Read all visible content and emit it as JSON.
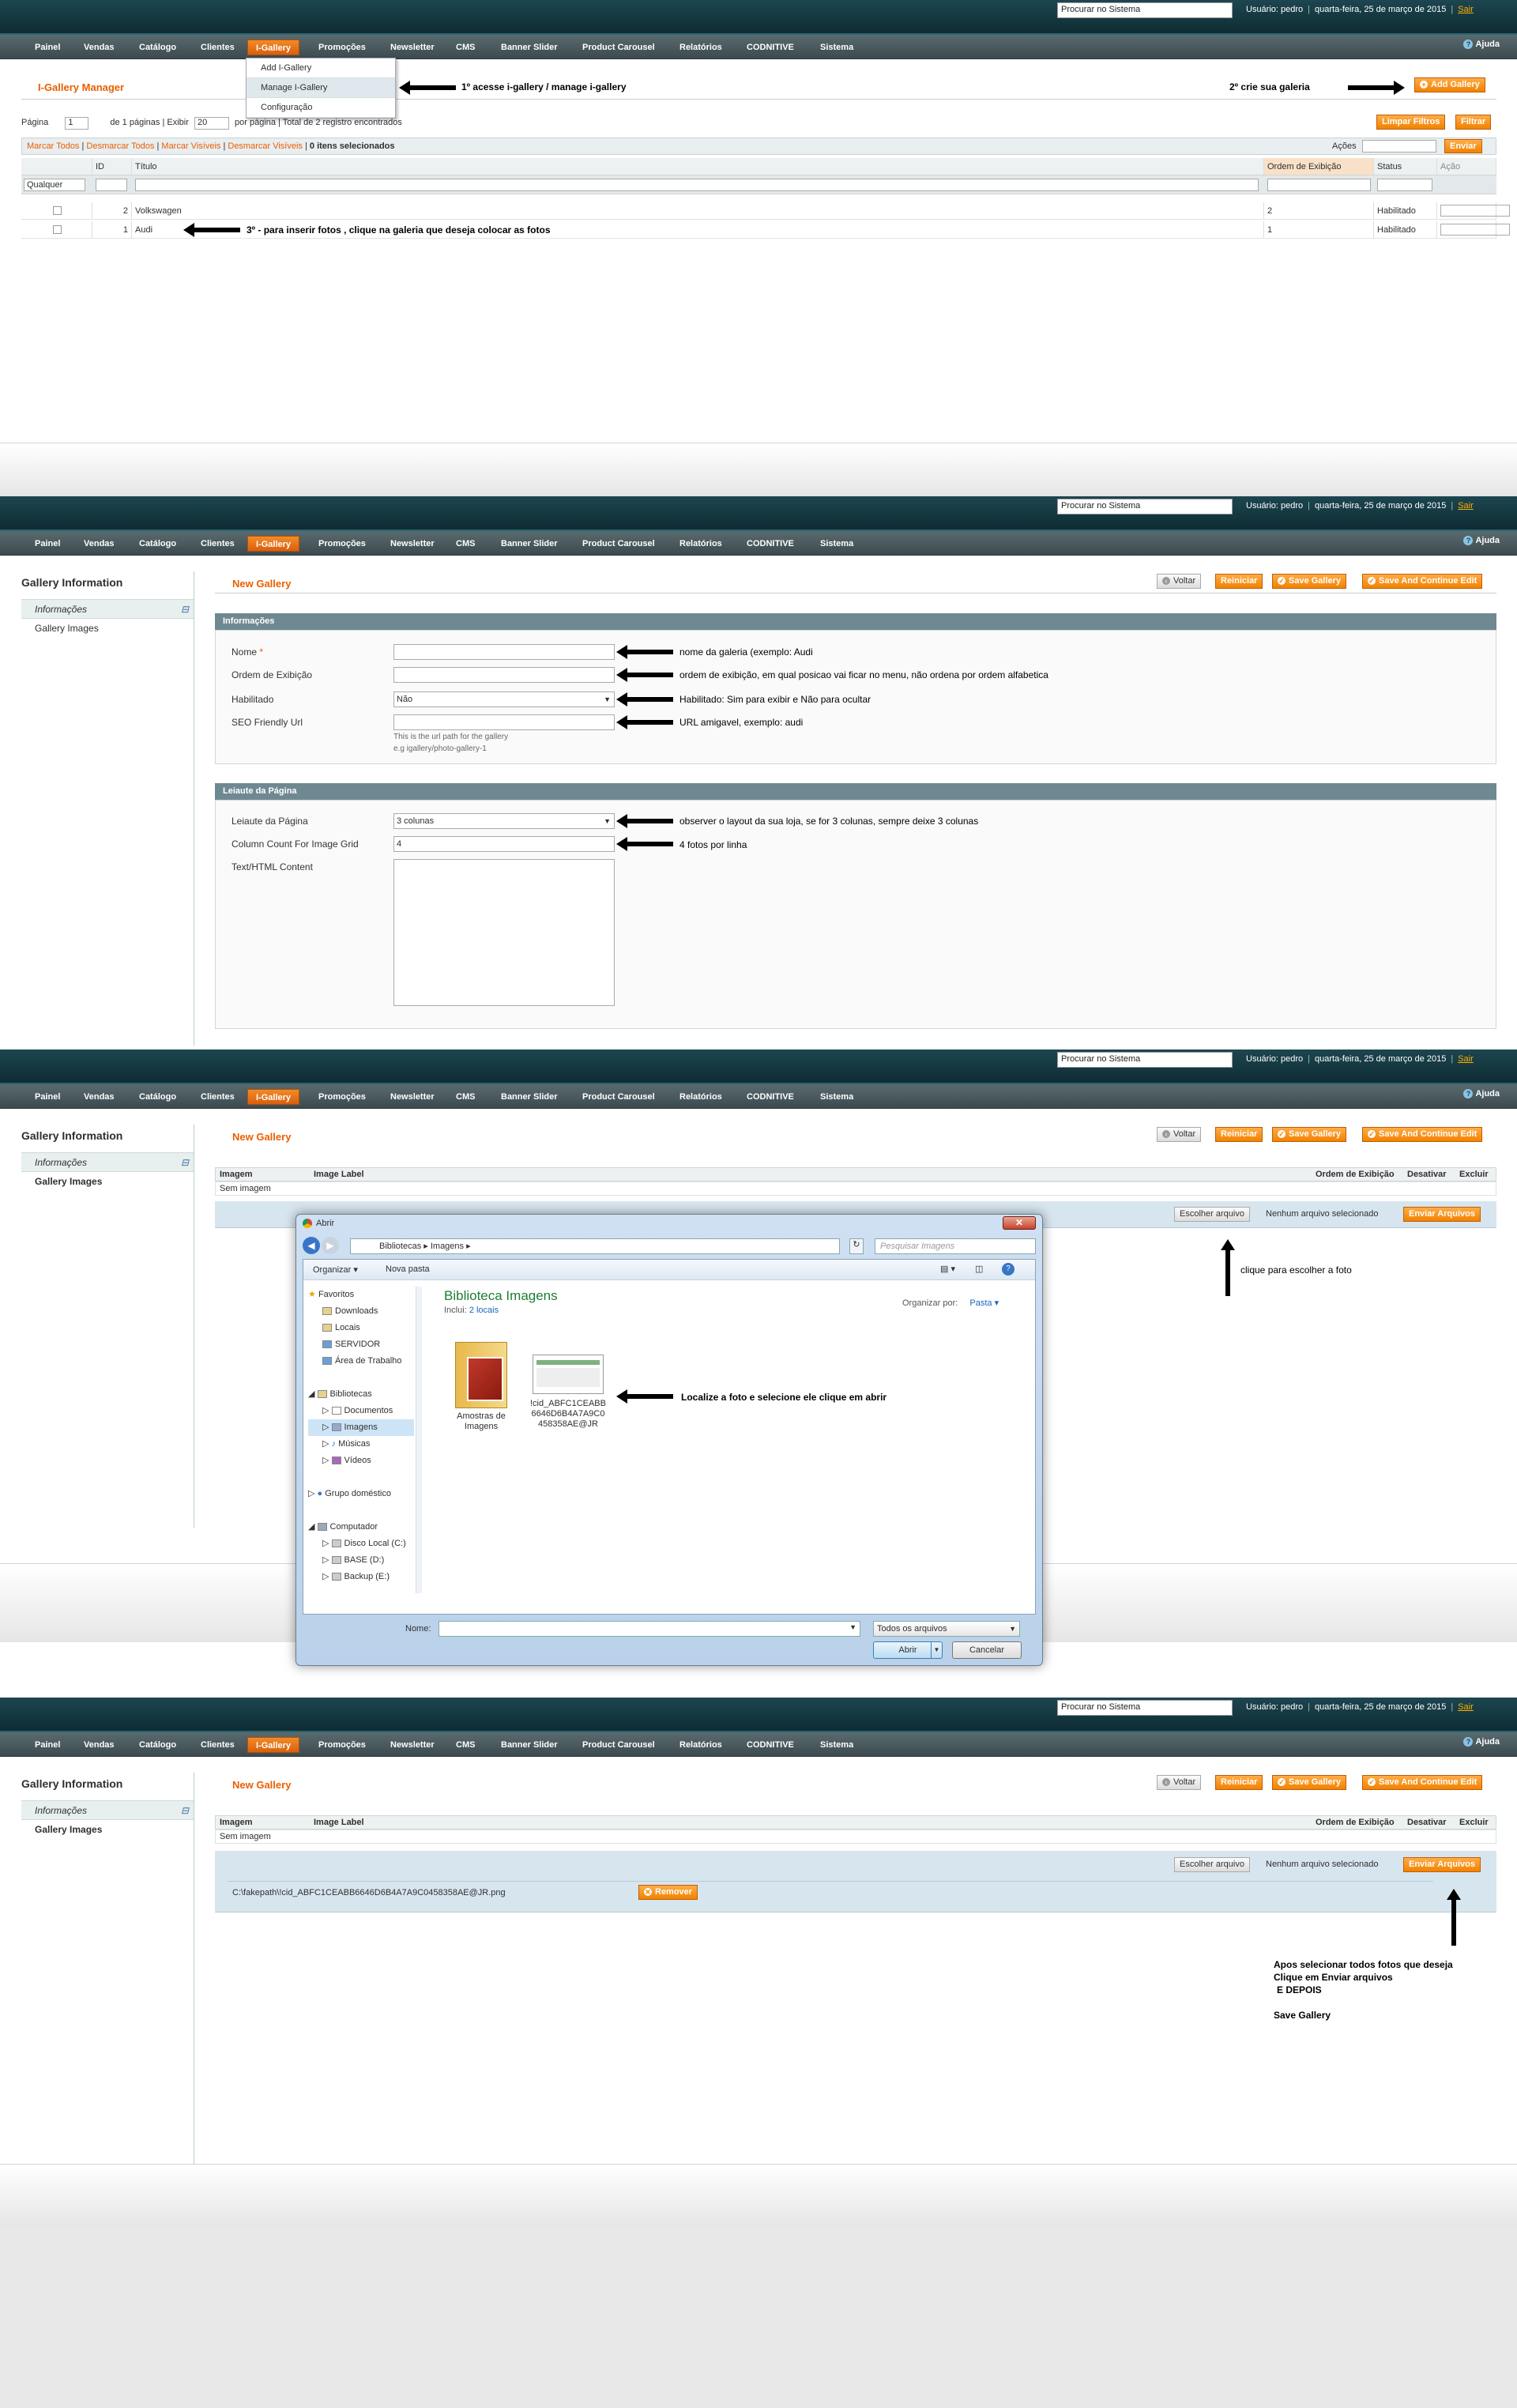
{
  "common": {
    "search_placeholder": "Procurar no Sistema",
    "user_text": "Usuário: pedro",
    "date_text": "quarta-feira, 25 de março de 2015",
    "logout": "Sair",
    "help": "Ajuda",
    "nav": [
      "Painel",
      "Vendas",
      "Catálogo",
      "Clientes",
      "I-Gallery",
      "Promoções",
      "Newsletter",
      "CMS",
      "Banner Slider",
      "Product Carousel",
      "Relatórios",
      "CODNITIVE",
      "Sistema"
    ],
    "buttons": {
      "back": "Voltar",
      "reset": "Reiniciar",
      "save": "Save Gallery",
      "save_continue": "Save And Continue Edit"
    },
    "sidebar": {
      "title": "Gallery Information",
      "tabs": [
        "Informações",
        "Gallery Images"
      ]
    },
    "new_gallery": "New Gallery"
  },
  "screen1": {
    "title": "I-Gallery Manager",
    "dropdown": [
      "Add I-Gallery",
      "Manage I-Gallery",
      "Configuração"
    ],
    "anno1": "1º acesse i-gallery / manage i-gallery",
    "anno2": "2º crie sua galeria",
    "anno3": "3º - para inserir fotos , clique na galeria que deseja colocar as fotos",
    "add_button": "Add Gallery",
    "pager": {
      "page_label": "Página",
      "page_value": "1",
      "of_pages": "de 1 páginas",
      "show": "Exibir",
      "per_page_value": "20",
      "per_page": "por página",
      "total": "Total de 2 registro encontrados"
    },
    "reset_filter": "Limpar Filtros",
    "search": "Filtrar",
    "massaction": {
      "links": [
        "Marcar Todos",
        "Desmarcar Todos",
        "Marcar Visíveis",
        "Desmarcar Visíveis"
      ],
      "selected": "0 itens selecionados",
      "actions_label": "Ações",
      "submit": "Enviar"
    },
    "columns": [
      "ID",
      "Título",
      "Ordem de Exibição",
      "Status",
      "Ação"
    ],
    "filter_any": "Qualquer",
    "rows": [
      {
        "id": "2",
        "title": "Volkswagen",
        "order": "2",
        "status": "Habilitado"
      },
      {
        "id": "1",
        "title": "Audi",
        "order": "1",
        "status": "Habilitado"
      }
    ]
  },
  "screen2": {
    "fieldset1": "Informações",
    "fields": [
      {
        "label": "Nome",
        "value": "",
        "anno": "nome da galeria (exemplo:  Audi"
      },
      {
        "label": "Ordem de Exibição",
        "value": "",
        "anno": "ordem de exibição, em qual posicao vai ficar no menu, não ordena por ordem alfabetica"
      },
      {
        "label": "Habilitado",
        "value": "Não",
        "anno": "Habilitado: Sim para exibir e Não para ocultar"
      },
      {
        "label": "SEO Friendly Url",
        "value": "",
        "anno": "URL amigavel, exemplo: audi"
      }
    ],
    "seo_note1": "This is the url path for the gallery",
    "seo_note2": "e.g igallery/photo-gallery-1",
    "fieldset2": "Leiaute da Página",
    "layout_label": "Leiaute da Página",
    "layout_value": "3 colunas",
    "layout_anno": "observer o layout da sua loja, se for 3 colunas, sempre deixe 3 colunas",
    "colcount_label": "Column Count For Image Grid",
    "colcount_value": "4",
    "colcount_anno": "4 fotos por linha",
    "content_label": "Text/HTML Content"
  },
  "screen3": {
    "columns": [
      "Imagem",
      "Image Label",
      "Ordem de Exibição",
      "Desativar",
      "Excluir"
    ],
    "no_image": "Sem imagem",
    "choose_file": "Escolher arquivo",
    "no_file": "Nenhum arquivo selecionado",
    "send_files": "Enviar Arquivos",
    "anno_choose": "clique para escolher a foto",
    "anno_dialog": "Localize a foto e selecione ele  clique em abrir",
    "dialog": {
      "title": "Abrir",
      "path": [
        "Bibliotecas",
        "Imagens"
      ],
      "search_placeholder": "Pesquisar Imagens",
      "organize": "Organizar",
      "new_folder": "Nova pasta",
      "lib_title": "Biblioteca Imagens",
      "includes": "Inclui:",
      "locations": "2 locais",
      "arrange_by": "Organizar por:",
      "arrange_value": "Pasta",
      "tree": [
        "Favoritos",
        "Downloads",
        "Locais",
        "SERVIDOR",
        "Área de Trabalho",
        "Bibliotecas",
        "Documentos",
        "Imagens",
        "Músicas",
        "Vídeos",
        "Grupo doméstico",
        "Computador",
        "Disco Local (C:)",
        "BASE (D:)",
        "Backup (E:)"
      ],
      "files": [
        "Amostras de Imagens",
        "!cid_ABFC1CEABB6646D6B4A7A9C0458358AE@JR"
      ],
      "name_label": "Nome:",
      "filetype": "Todos os arquivos",
      "open": "Abrir",
      "cancel": "Cancelar"
    }
  },
  "screen4": {
    "file_path": "C:\\fakepath\\!cid_ABFC1CEABB6646D6B4A7A9C0458358AE@JR.png",
    "remove": "Remover",
    "anno_lines": [
      "Apos selecionar todos fotos que deseja",
      "Clique em Enviar arquivos",
      "E DEPOIS",
      "",
      "Save Gallery"
    ]
  }
}
